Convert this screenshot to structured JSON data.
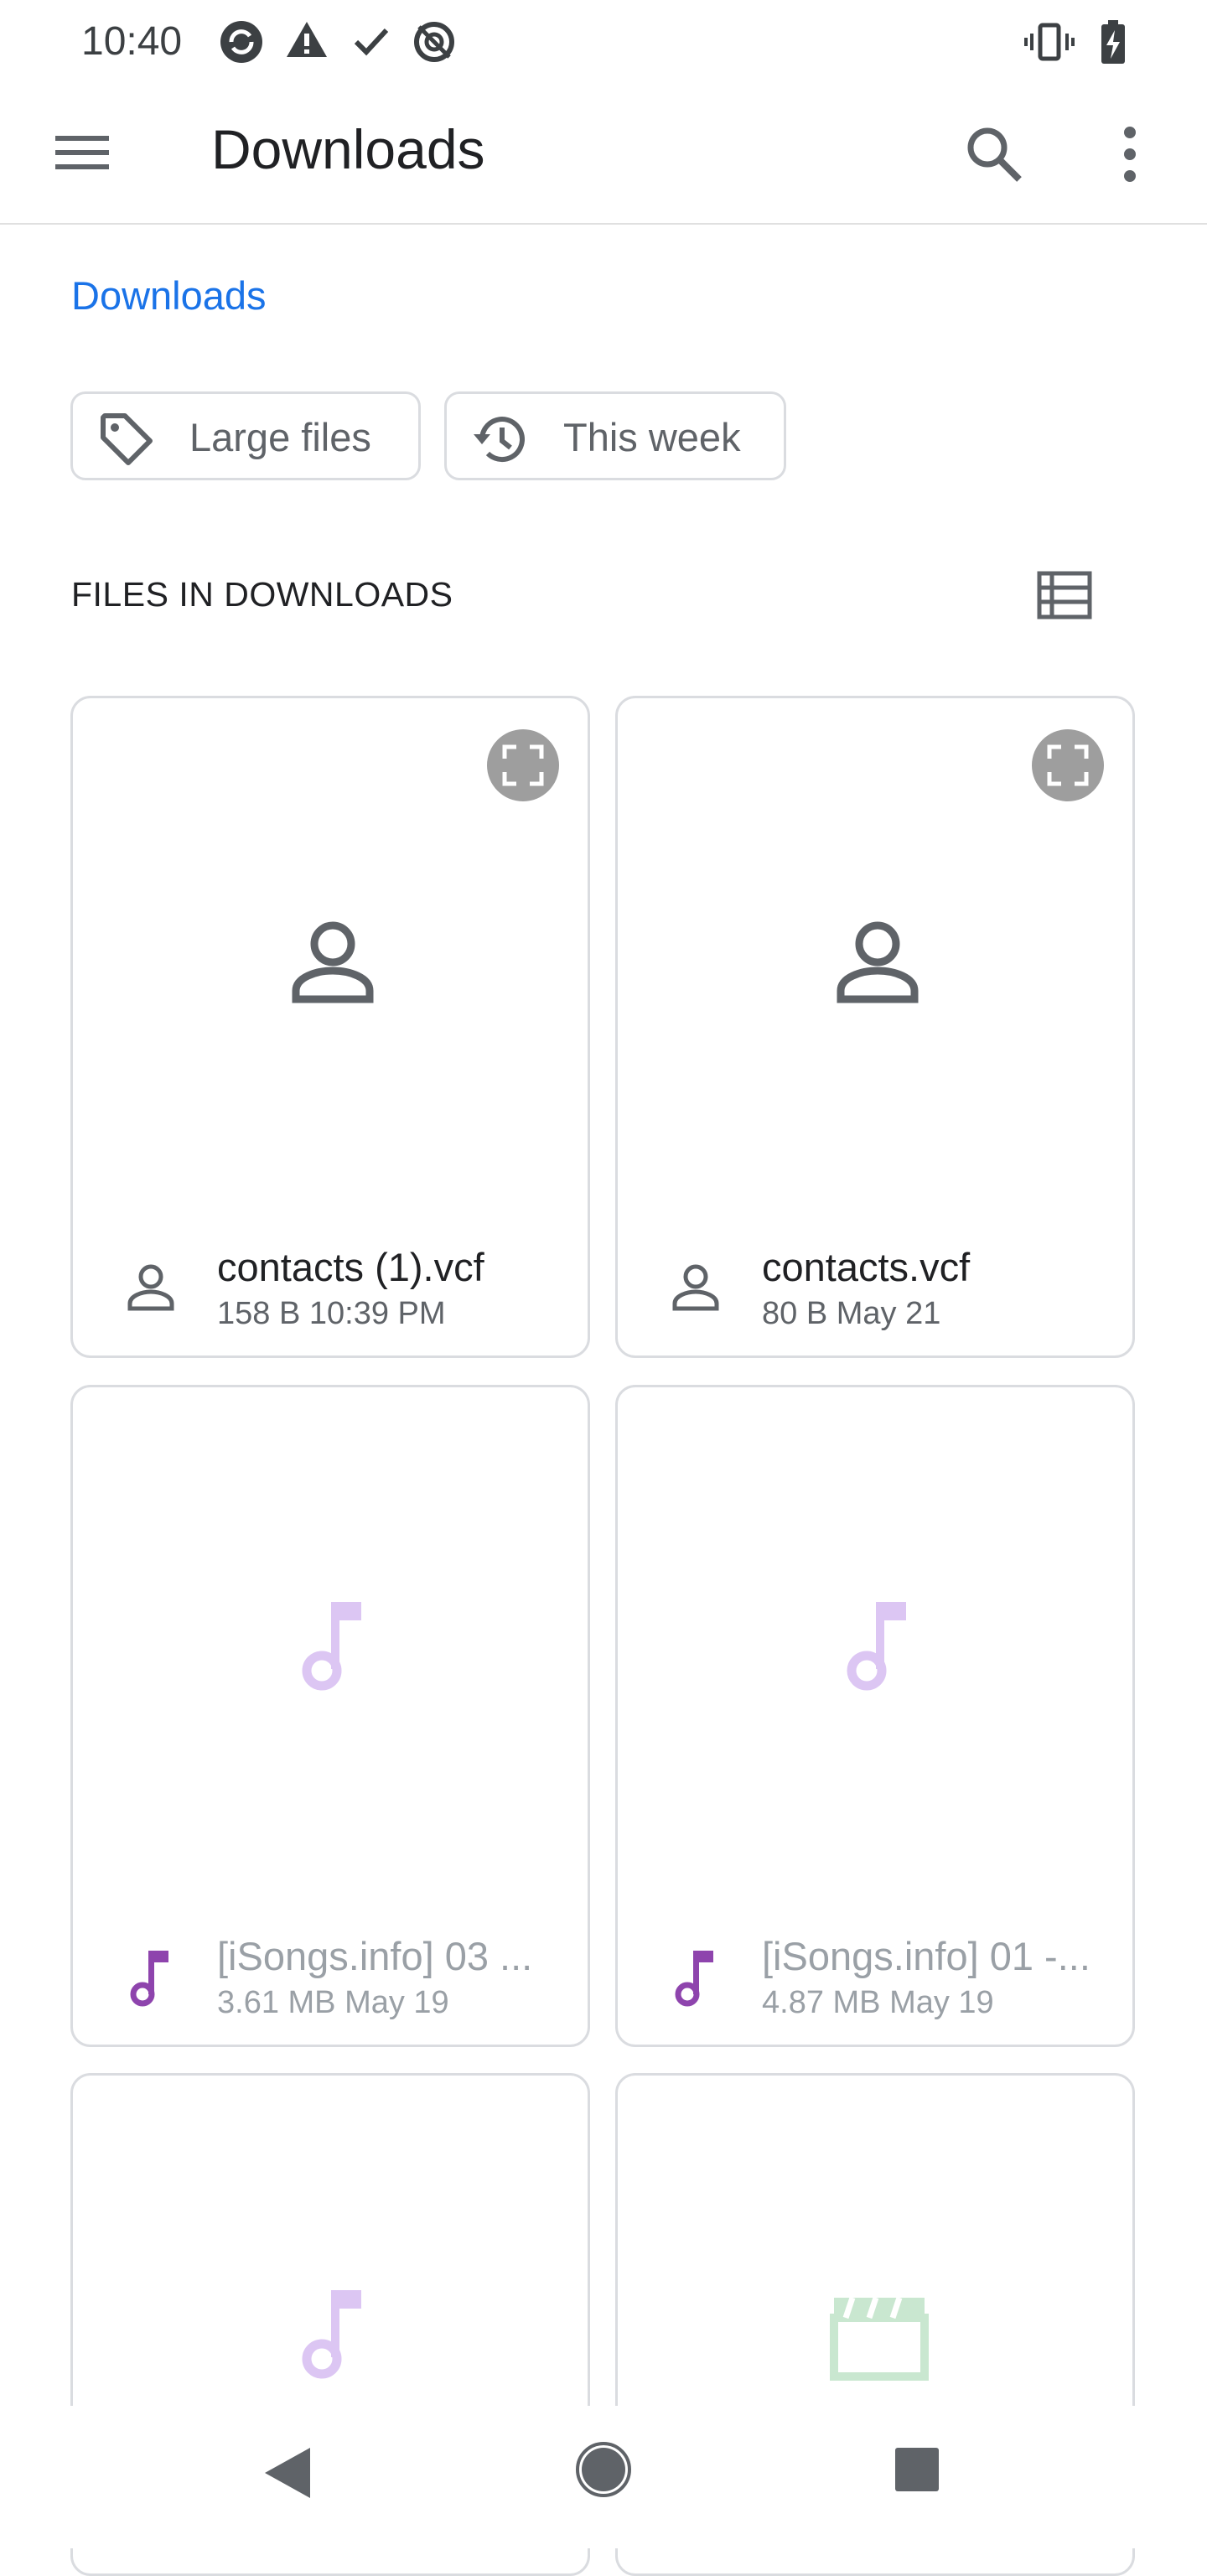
{
  "status_bar": {
    "time": "10:40",
    "left_icons": [
      "sync-icon",
      "alert-icon",
      "check-icon",
      "data-saver-icon"
    ],
    "right_icons": [
      "vibrate-icon",
      "battery-charging-icon"
    ]
  },
  "app_bar": {
    "title": "Downloads",
    "menu_icon": "hamburger-menu-icon",
    "search_icon": "search-icon",
    "overflow_icon": "more-vert-icon"
  },
  "breadcrumb": {
    "label": "Downloads"
  },
  "filters": [
    {
      "label": "Large files",
      "icon": "label-tag-icon"
    },
    {
      "label": "This week",
      "icon": "history-icon"
    }
  ],
  "section": {
    "title": "FILES IN DOWNLOADS",
    "view_toggle_icon": "list-view-icon"
  },
  "files": [
    {
      "name": "contacts (1).vcf",
      "meta": "158 B 10:39 PM",
      "type": "contact"
    },
    {
      "name": "contacts.vcf",
      "meta": "80 B May 21",
      "type": "contact"
    },
    {
      "name": "[iSongs.info] 03 ...",
      "meta": "3.61 MB May 19",
      "type": "audio"
    },
    {
      "name": "[iSongs.info] 01 -...",
      "meta": "4.87 MB May 19",
      "type": "audio"
    },
    {
      "name": "",
      "meta": "",
      "type": "audio"
    },
    {
      "name": "",
      "meta": "",
      "type": "video"
    }
  ],
  "colors": {
    "accent": "#1a73e8",
    "audio": "#8e44ad",
    "audio_light": "#dcc6f3",
    "video_light": "#c9e7d0",
    "icon_gray": "#5f6368"
  },
  "nav_bar": {
    "back_icon": "back-triangle-icon",
    "home_icon": "home-circle-icon",
    "recents_icon": "recents-square-icon"
  }
}
